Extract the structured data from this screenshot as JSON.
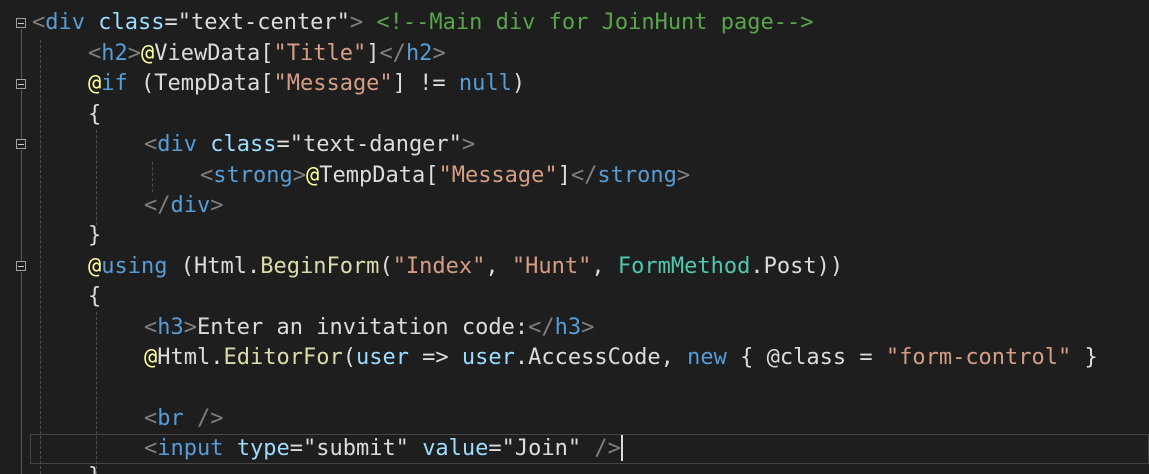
{
  "colors": {
    "background": "#1e1e1e",
    "tag": "#569cd6",
    "attribute": "#9cdcfe",
    "string": "#d69d85",
    "comment": "#57a64a",
    "punctuation": "#808080",
    "text": "#dcdcdc"
  },
  "code": {
    "l1": {
      "open": "<",
      "tag": "div",
      "attr": "class",
      "eq": "=",
      "val": "\"text-center\"",
      "close": ">",
      "comment": "<!--Main div for JoinHunt page-->"
    },
    "l2": {
      "open": "<",
      "tag": "h2",
      "close": ">",
      "at": "@",
      "obj": "ViewData",
      "lb": "[",
      "key": "\"Title\"",
      "rb": "]",
      "endopen": "</",
      "endtag": "h2",
      "endclose": ">"
    },
    "l3": {
      "at": "@",
      "kw": "if",
      "lp": " (",
      "obj": "TempData",
      "lb": "[",
      "key": "\"Message\"",
      "rb": "]",
      "op": " != ",
      "null": "null",
      "rp": ")"
    },
    "l4": {
      "brace": "{"
    },
    "l5": {
      "open": "<",
      "tag": "div",
      "attr": "class",
      "eq": "=",
      "val": "\"text-danger\"",
      "close": ">"
    },
    "l6": {
      "open": "<",
      "tag": "strong",
      "close": ">",
      "at": "@",
      "obj": "TempData",
      "lb": "[",
      "key": "\"Message\"",
      "rb": "]",
      "endopen": "</",
      "endtag": "strong",
      "endclose": ">"
    },
    "l7": {
      "endopen": "</",
      "endtag": "div",
      "endclose": ">"
    },
    "l8": {
      "brace": "}"
    },
    "l9": {
      "at": "@",
      "kw": "using",
      "lp": " (",
      "obj": "Html",
      "dot": ".",
      "method": "BeginForm",
      "lp2": "(",
      "a1": "\"Index\"",
      "c1": ", ",
      "a2": "\"Hunt\"",
      "c2": ", ",
      "type": "FormMethod",
      "dot2": ".",
      "member": "Post",
      "rp": "))"
    },
    "l10": {
      "brace": "{"
    },
    "l11": {
      "open": "<",
      "tag": "h3",
      "close": ">",
      "text": "Enter an invitation code:",
      "endopen": "</",
      "endtag": "h3",
      "endclose": ">"
    },
    "l12": {
      "at": "@",
      "obj": "Html",
      "dot": ".",
      "method": "EditorFor",
      "lp": "(",
      "param": "user",
      "arrow": " => ",
      "param2": "user",
      "dot2": ".",
      "member": "AccessCode",
      "c1": ", ",
      "kw": "new",
      "ob": " { ",
      "at2": "@",
      "prop": "class",
      "eq": " = ",
      "val": "\"form-control\"",
      "cb": " }"
    },
    "l13": {
      "open": "<",
      "tag": "br",
      "close": " />"
    },
    "l14": {
      "open": "<",
      "tag": "input",
      "attr1": "type",
      "eq1": "=",
      "val1": "\"submit\"",
      "attr2": "value",
      "eq2": "=",
      "val2": "\"Join\"",
      "close": " />"
    },
    "l15": {
      "brace": "}"
    }
  }
}
